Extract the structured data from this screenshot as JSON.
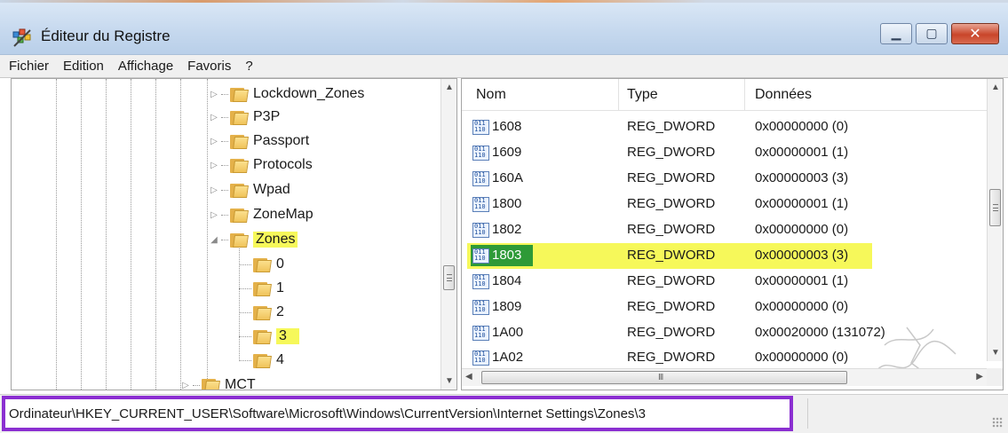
{
  "window": {
    "title": "Éditeur du Registre",
    "controls": {
      "minimize_icon": "minimize-icon",
      "maximize_icon": "maximize-icon",
      "close_icon": "close-icon"
    }
  },
  "menu": {
    "items": [
      "Fichier",
      "Edition",
      "Affichage",
      "Favoris",
      "?"
    ]
  },
  "tree": {
    "items": [
      {
        "label": "Lockdown_Zones",
        "expander": "▷"
      },
      {
        "label": "P3P",
        "expander": "▷"
      },
      {
        "label": "Passport",
        "expander": "▷"
      },
      {
        "label": "Protocols",
        "expander": "▷"
      },
      {
        "label": "Wpad",
        "expander": "▷"
      },
      {
        "label": "ZoneMap",
        "expander": "▷"
      },
      {
        "label": "Zones",
        "expander": "◢",
        "highlighted": true
      },
      {
        "label": "0"
      },
      {
        "label": "1"
      },
      {
        "label": "2"
      },
      {
        "label": "3",
        "highlighted": true
      },
      {
        "label": "4"
      },
      {
        "label": "MCT",
        "expander": "▷"
      }
    ]
  },
  "list": {
    "headers": {
      "name": "Nom",
      "type": "Type",
      "data": "Données"
    },
    "rows": [
      {
        "name": "1608",
        "type": "REG_DWORD",
        "data": "0x00000000 (0)"
      },
      {
        "name": "1609",
        "type": "REG_DWORD",
        "data": "0x00000001 (1)"
      },
      {
        "name": "160A",
        "type": "REG_DWORD",
        "data": "0x00000003 (3)"
      },
      {
        "name": "1800",
        "type": "REG_DWORD",
        "data": "0x00000001 (1)"
      },
      {
        "name": "1802",
        "type": "REG_DWORD",
        "data": "0x00000000 (0)"
      },
      {
        "name": "1803",
        "type": "REG_DWORD",
        "data": "0x00000003 (3)",
        "selected": true
      },
      {
        "name": "1804",
        "type": "REG_DWORD",
        "data": "0x00000001 (1)"
      },
      {
        "name": "1809",
        "type": "REG_DWORD",
        "data": "0x00000000 (0)"
      },
      {
        "name": "1A00",
        "type": "REG_DWORD",
        "data": "0x00020000 (131072)"
      },
      {
        "name": "1A02",
        "type": "REG_DWORD",
        "data": "0x00000000 (0)"
      }
    ],
    "hscroll_grip": "III"
  },
  "status": {
    "path": "Ordinateur\\HKEY_CURRENT_USER\\Software\\Microsoft\\Windows\\CurrentVersion\\Internet Settings\\Zones\\3"
  },
  "colors": {
    "highlight_yellow": "#f6f85a",
    "selection_green": "#2e9a37",
    "status_border_purple": "#8b2fd1"
  }
}
